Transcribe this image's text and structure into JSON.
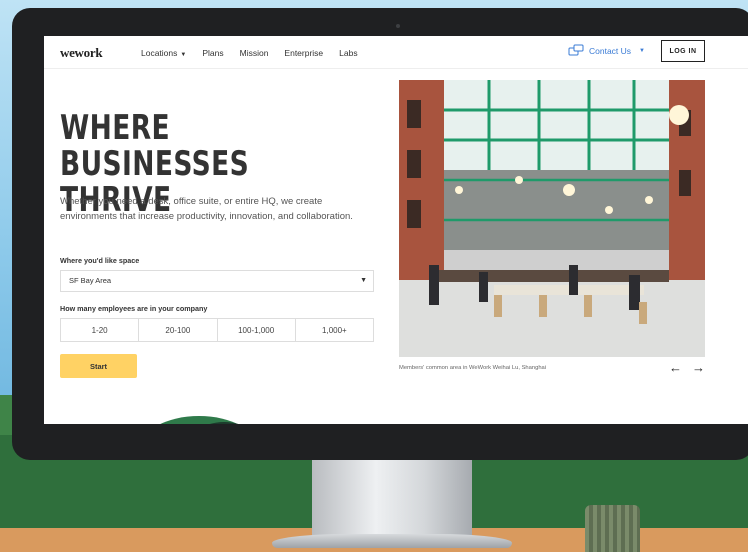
{
  "nav": {
    "logo": "wework",
    "links": [
      "Locations",
      "Plans",
      "Mission",
      "Enterprise",
      "Labs"
    ],
    "contact": "Contact Us",
    "login": "LOG IN"
  },
  "hero": {
    "title_line1": "WHERE BUSINESSES",
    "title_line2": "THRIVE",
    "description": "Whether you need a desk, office suite, or entire HQ, we create environments that increase productivity, innovation, and collaboration."
  },
  "form": {
    "space_label": "Where you'd like space",
    "space_value": "SF Bay Area",
    "employees_label": "How many employees are in your company",
    "employee_options": [
      "1-20",
      "20-100",
      "100-1,000",
      "1,000+"
    ],
    "start_label": "Start"
  },
  "photo": {
    "caption": "Members' common area in WeWork Weihai Lu, Shanghai",
    "prev_arrow": "←",
    "next_arrow": "→"
  },
  "colors": {
    "accent_blue": "#3a7bd5",
    "start_yellow": "#ffd264",
    "steel_green": "#1f9a6a"
  },
  "icons": [
    "chevron-down-icon",
    "chat-bubbles-icon",
    "arrow-left-icon",
    "arrow-right-icon"
  ]
}
